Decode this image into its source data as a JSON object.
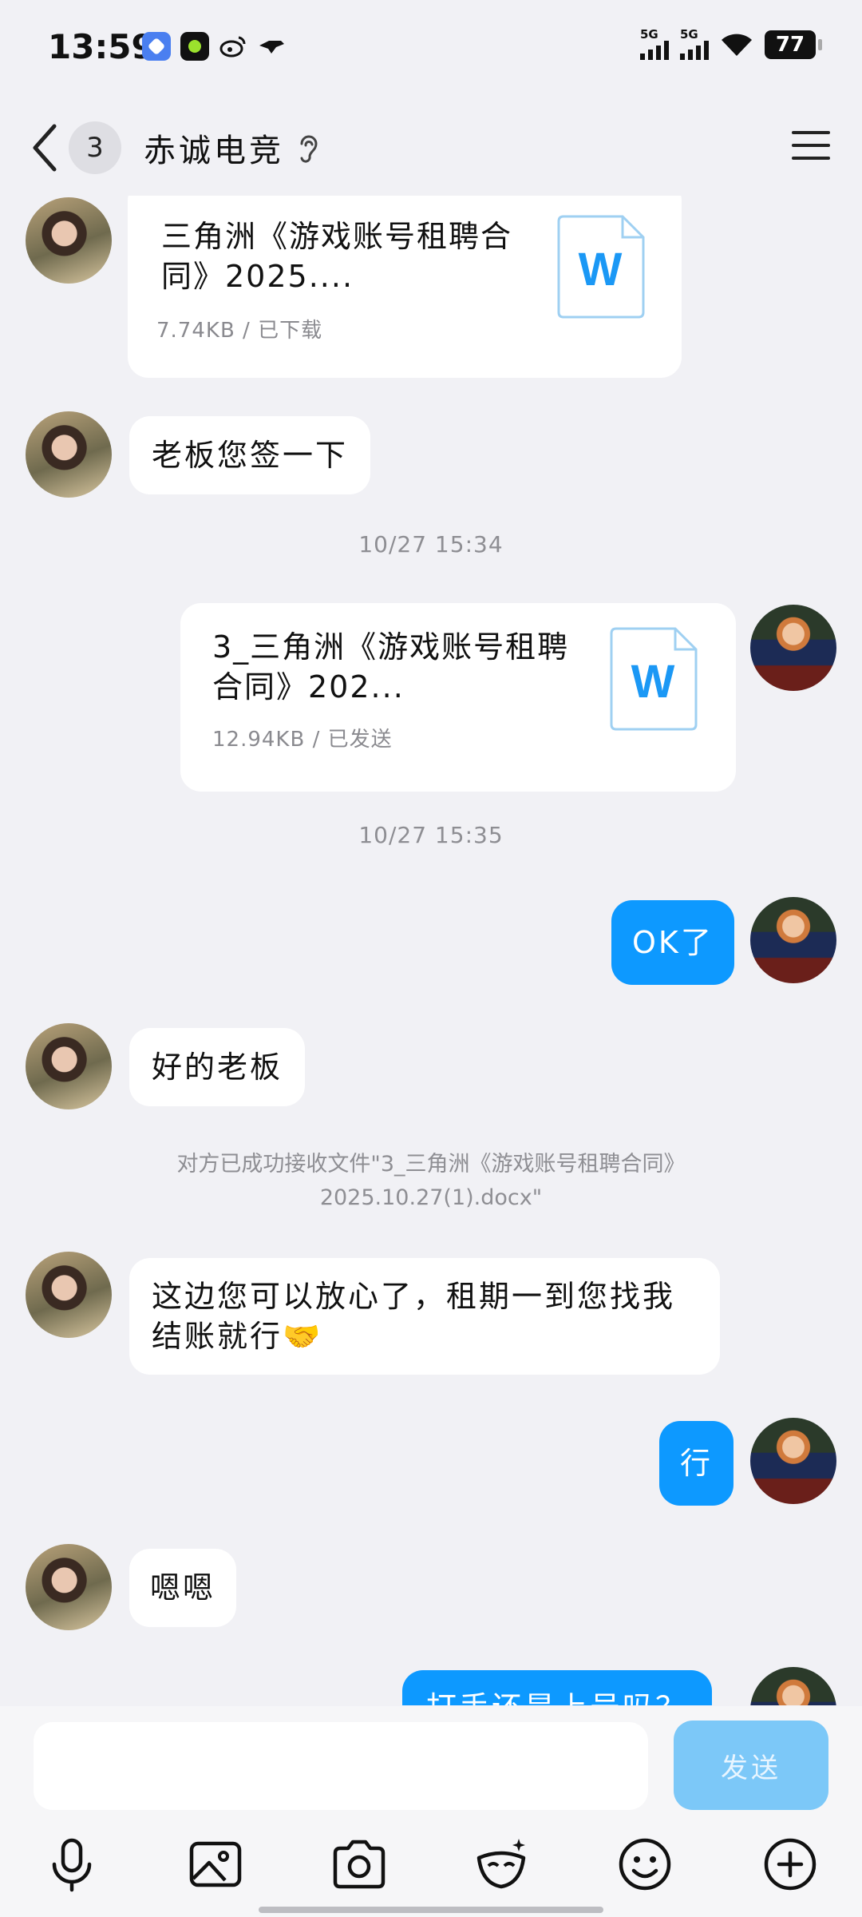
{
  "status_bar": {
    "time": "13:59",
    "signal1_label": "5G",
    "signal2_label": "5G",
    "battery": "77"
  },
  "header": {
    "badge_count": "3",
    "title": "赤诚电竞"
  },
  "messages": {
    "file1_name": "三角洲《游戏账号租聘合同》2025....",
    "file1_meta": "7.74KB / 已下载",
    "msg_sign": "老板您签一下",
    "time1": "10/27 15:34",
    "file2_name": "3_三角洲《游戏账号租聘合同》202...",
    "file2_meta": "12.94KB / 已发送",
    "time2": "10/27 15:35",
    "msg_ok": "OK了",
    "msg_good": "好的老板",
    "sys_note": "对方已成功接收文件\"3_三角洲《游戏账号租聘合同》2025.10.27(1).docx\"",
    "msg_relax": "这边您可以放心了，租期一到您找我结账就行🤝",
    "msg_xing": "行",
    "msg_enen": "嗯嗯",
    "msg_partial": "打手还是上号吗？"
  },
  "input": {
    "placeholder": "",
    "send_label": "发送"
  },
  "colors": {
    "accent": "#0d99ff",
    "send_disabled": "#7cc8f8",
    "background": "#f1f1f5"
  },
  "icons": [
    "back-icon",
    "ear-icon",
    "menu-icon",
    "word-file-icon",
    "mic-icon",
    "gallery-icon",
    "camera-icon",
    "sticker-icon",
    "emoji-icon",
    "plus-icon"
  ]
}
